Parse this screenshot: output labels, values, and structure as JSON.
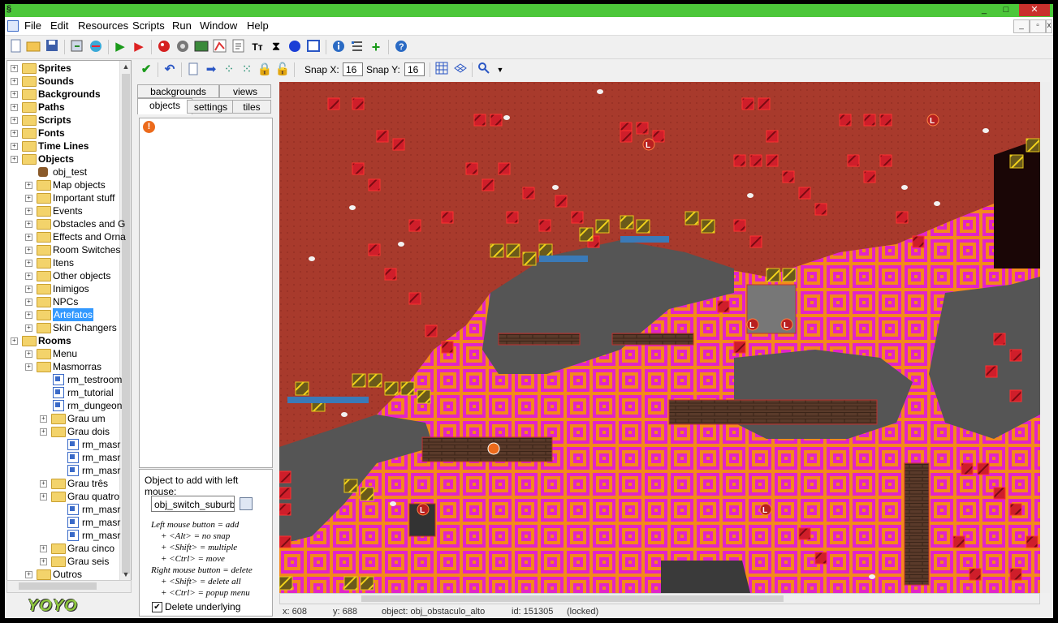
{
  "window": {
    "menu": [
      "File",
      "Edit",
      "Resources",
      "Scripts",
      "Run",
      "Window",
      "Help"
    ],
    "controls": {
      "minimize": "_",
      "maximize": "□",
      "close": "✕"
    }
  },
  "tree": {
    "items": [
      {
        "label": "Sprites",
        "bold": true,
        "level": 0,
        "type": "folder"
      },
      {
        "label": "Sounds",
        "bold": true,
        "level": 0,
        "type": "folder"
      },
      {
        "label": "Backgrounds",
        "bold": true,
        "level": 0,
        "type": "folder"
      },
      {
        "label": "Paths",
        "bold": true,
        "level": 0,
        "type": "folder"
      },
      {
        "label": "Scripts",
        "bold": true,
        "level": 0,
        "type": "folder"
      },
      {
        "label": "Fonts",
        "bold": true,
        "level": 0,
        "type": "folder"
      },
      {
        "label": "Time Lines",
        "bold": true,
        "level": 0,
        "type": "folder"
      },
      {
        "label": "Objects",
        "bold": true,
        "level": 0,
        "type": "folder"
      },
      {
        "label": "obj_test",
        "bold": false,
        "level": 1,
        "type": "object"
      },
      {
        "label": "Map objects",
        "bold": false,
        "level": 1,
        "type": "folder"
      },
      {
        "label": "Important stuff",
        "bold": false,
        "level": 1,
        "type": "folder"
      },
      {
        "label": "Events",
        "bold": false,
        "level": 1,
        "type": "folder"
      },
      {
        "label": "Obstacles and G",
        "bold": false,
        "level": 1,
        "type": "folder"
      },
      {
        "label": "Effects and Orna",
        "bold": false,
        "level": 1,
        "type": "folder"
      },
      {
        "label": "Room Switches",
        "bold": false,
        "level": 1,
        "type": "folder"
      },
      {
        "label": "Itens",
        "bold": false,
        "level": 1,
        "type": "folder"
      },
      {
        "label": "Other objects",
        "bold": false,
        "level": 1,
        "type": "folder"
      },
      {
        "label": "Inimigos",
        "bold": false,
        "level": 1,
        "type": "folder"
      },
      {
        "label": "NPCs",
        "bold": false,
        "level": 1,
        "type": "folder"
      },
      {
        "label": "Artefatos",
        "bold": false,
        "level": 1,
        "type": "folder",
        "selected": true
      },
      {
        "label": "Skin Changers",
        "bold": false,
        "level": 1,
        "type": "folder"
      },
      {
        "label": "Rooms",
        "bold": true,
        "level": 0,
        "type": "folder"
      },
      {
        "label": "Menu",
        "bold": false,
        "level": 1,
        "type": "folder"
      },
      {
        "label": "Masmorras",
        "bold": false,
        "level": 1,
        "type": "folder"
      },
      {
        "label": "rm_testroom",
        "bold": false,
        "level": 2,
        "type": "room"
      },
      {
        "label": "rm_tutorial",
        "bold": false,
        "level": 2,
        "type": "room"
      },
      {
        "label": "rm_dungeon",
        "bold": false,
        "level": 2,
        "type": "room"
      },
      {
        "label": "Grau um",
        "bold": false,
        "level": 2,
        "type": "folder"
      },
      {
        "label": "Grau dois",
        "bold": false,
        "level": 2,
        "type": "folder"
      },
      {
        "label": "rm_masr",
        "bold": false,
        "level": 3,
        "type": "room"
      },
      {
        "label": "rm_masr",
        "bold": false,
        "level": 3,
        "type": "room"
      },
      {
        "label": "rm_masr",
        "bold": false,
        "level": 3,
        "type": "room"
      },
      {
        "label": "Grau três",
        "bold": false,
        "level": 2,
        "type": "folder"
      },
      {
        "label": "Grau quatro",
        "bold": false,
        "level": 2,
        "type": "folder"
      },
      {
        "label": "rm_masr",
        "bold": false,
        "level": 3,
        "type": "room"
      },
      {
        "label": "rm_masr",
        "bold": false,
        "level": 3,
        "type": "room"
      },
      {
        "label": "rm_masr",
        "bold": false,
        "level": 3,
        "type": "room"
      },
      {
        "label": "Grau cinco",
        "bold": false,
        "level": 2,
        "type": "folder"
      },
      {
        "label": "Grau seis",
        "bold": false,
        "level": 2,
        "type": "folder"
      },
      {
        "label": "Outros",
        "bold": false,
        "level": 1,
        "type": "folder"
      }
    ]
  },
  "logo": "YOYO",
  "room_toolbar": {
    "snap_x_label": "Snap X:",
    "snap_x": "16",
    "snap_y_label": "Snap Y:",
    "snap_y": "16"
  },
  "tabs": {
    "row1": [
      "backgrounds",
      "views"
    ],
    "row2": [
      "objects",
      "settings",
      "tiles"
    ],
    "active": "objects"
  },
  "add_panel": {
    "title": "Object to add with left mouse:",
    "object": "obj_switch_suburbio",
    "hints": [
      "Left mouse button = add",
      "+ <Alt> = no snap",
      "+ <Shift> = multiple",
      "+ <Ctrl> = move",
      "Right mouse button = delete",
      "+ <Shift> = delete all",
      "+ <Ctrl> = popup menu"
    ],
    "delete_underlying_label": "Delete underlying",
    "delete_underlying_checked": true
  },
  "status": {
    "x": "x: 608",
    "y": "y: 688",
    "object": "object: obj_obstaculo_alto",
    "id": "id: 151305",
    "locked": "(locked)"
  },
  "colors": {
    "titlebar": "#4cc73a",
    "lava_ground": "#a83a2c",
    "stone_floor": "#555555",
    "magenta_tile": "#e224c8",
    "orange_tile": "#f4881c",
    "selection_blue": "#3399ff"
  }
}
